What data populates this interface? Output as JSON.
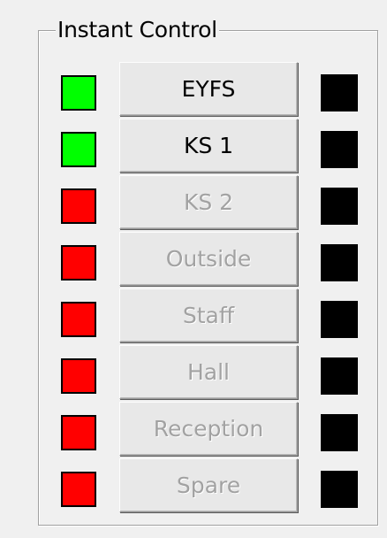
{
  "group": {
    "title": "Instant Control"
  },
  "rows": [
    {
      "label": "EYFS",
      "enabled": true,
      "indicator": "green",
      "status": "black"
    },
    {
      "label": "KS 1",
      "enabled": true,
      "indicator": "green",
      "status": "black"
    },
    {
      "label": "KS 2",
      "enabled": false,
      "indicator": "red",
      "status": "black"
    },
    {
      "label": "Outside",
      "enabled": false,
      "indicator": "red",
      "status": "black"
    },
    {
      "label": "Staff",
      "enabled": false,
      "indicator": "red",
      "status": "black"
    },
    {
      "label": "Hall",
      "enabled": false,
      "indicator": "red",
      "status": "black"
    },
    {
      "label": "Reception",
      "enabled": false,
      "indicator": "red",
      "status": "black"
    },
    {
      "label": "Spare",
      "enabled": false,
      "indicator": "red",
      "status": "black"
    }
  ],
  "colors": {
    "green": "#00ff00",
    "red": "#ff0000",
    "black": "#000000",
    "face": "#f0f0f0"
  }
}
